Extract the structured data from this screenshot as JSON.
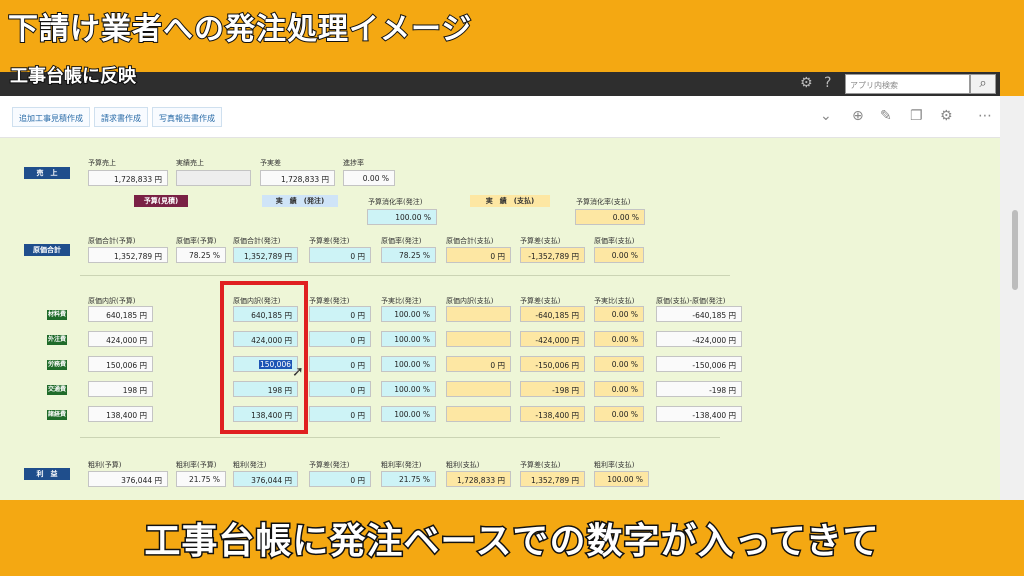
{
  "overlay": {
    "title": "下請け業者への発注処理イメージ",
    "subtitle": "工事台帳に反映",
    "caption": "工事台帳に発注ベースでの数字が入ってきて"
  },
  "appbar": {
    "search_placeholder": "アプリ内検索",
    "icons": [
      "gear-icon",
      "help-icon",
      "search-icon"
    ]
  },
  "toolbar": {
    "buttons": [
      "追加工事見積作成",
      "請求書作成",
      "写真報告書作成"
    ],
    "icons": [
      "chevron-down-icon",
      "plus-icon",
      "edit-icon",
      "copy-icon",
      "gear-icon",
      "more-icon"
    ]
  },
  "sales": {
    "label": "売　上",
    "headers": [
      "予算売上",
      "実績売上",
      "予実差",
      "進捗率"
    ],
    "values": [
      "1,728,833 円",
      "",
      "1,728,833 円",
      "0.00 %"
    ]
  },
  "tags": {
    "budget": "予算(見積)",
    "actual_order": "実　績　(発注)",
    "actual_pay": "実　績　(支払)"
  },
  "budget_usage": {
    "order_header": "予算消化率(発注)",
    "order_value": "100.00 %",
    "pay_header": "予算消化率(支払)",
    "pay_value": "0.00 %"
  },
  "cost_total": {
    "label": "原価合計",
    "headers": [
      "原価合計(予算)",
      "原価率(予算)",
      "原価合計(発注)",
      "予算差(発注)",
      "原価率(発注)",
      "原価合計(支払)",
      "予算差(支払)",
      "原価率(支払)"
    ],
    "values": [
      "1,352,789 円",
      "78.25 %",
      "1,352,789 円",
      "0 円",
      "78.25 %",
      "0 円",
      "-1,352,789 円",
      "0.00 %"
    ]
  },
  "breakdown": {
    "headers": [
      "原価内訳(予算)",
      "原価内訳(発注)",
      "予算差(発注)",
      "予実比(発注)",
      "原価内訳(支払)",
      "予算差(支払)",
      "予実比(支払)",
      "原価(支払)-原価(発注)"
    ],
    "rows": [
      {
        "label": "材料費",
        "values": [
          "640,185 円",
          "640,185 円",
          "0 円",
          "100.00 %",
          "",
          "-640,185 円",
          "0.00 %",
          "-640,185 円"
        ]
      },
      {
        "label": "外注費",
        "values": [
          "424,000 円",
          "424,000 円",
          "0 円",
          "100.00 %",
          "",
          "-424,000 円",
          "0.00 %",
          "-424,000 円"
        ]
      },
      {
        "label": "労務費",
        "values": [
          "150,006 円",
          "150,006",
          "0 円",
          "100.00 %",
          "0 円",
          "-150,006 円",
          "0.00 %",
          "-150,006 円"
        ]
      },
      {
        "label": "交通費",
        "values": [
          "198 円",
          "198 円",
          "0 円",
          "100.00 %",
          "",
          "-198 円",
          "0.00 %",
          "-198 円"
        ]
      },
      {
        "label": "諸経費",
        "values": [
          "138,400 円",
          "138,400 円",
          "0 円",
          "100.00 %",
          "",
          "-138,400 円",
          "0.00 %",
          "-138,400 円"
        ]
      }
    ]
  },
  "profit": {
    "label": "利　益",
    "headers": [
      "粗利(予算)",
      "粗利率(予算)",
      "粗利(発注)",
      "予算差(発注)",
      "粗利率(発注)",
      "粗利(支払)",
      "予算差(支払)",
      "粗利率(支払)"
    ],
    "values": [
      "376,044 円",
      "21.75 %",
      "376,044 円",
      "0 円",
      "21.75 %",
      "1,728,833 円",
      "1,352,789 円",
      "100.00 %"
    ]
  }
}
